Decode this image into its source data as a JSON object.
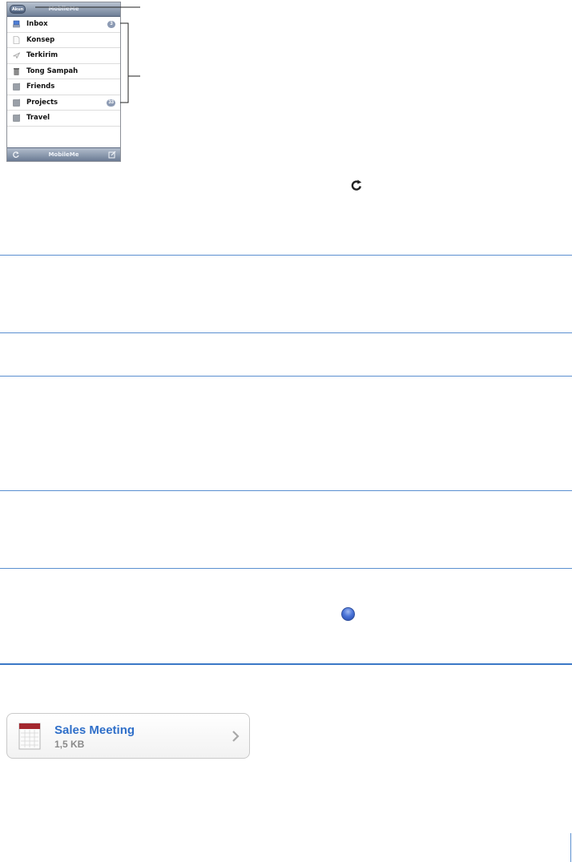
{
  "phone": {
    "back_label": "Akun",
    "nav_title": "MobileMe",
    "mailboxes": [
      {
        "label": "Inbox",
        "icon": "inbox-icon",
        "badge": "3"
      },
      {
        "label": "Konsep",
        "icon": "draft-icon",
        "badge": ""
      },
      {
        "label": "Terkirim",
        "icon": "sent-icon",
        "badge": ""
      },
      {
        "label": "Tong Sampah",
        "icon": "trash-icon",
        "badge": ""
      },
      {
        "label": "Friends",
        "icon": "folder-icon",
        "badge": ""
      },
      {
        "label": "Projects",
        "icon": "folder-icon",
        "badge": "33"
      },
      {
        "label": "Travel",
        "icon": "folder-icon",
        "badge": ""
      }
    ],
    "toolbar_title": "MobileMe"
  },
  "attachment": {
    "title": "Sales Meeting",
    "size": "1,5 KB"
  },
  "colors": {
    "rule": "#5a8fd0",
    "link_blue": "#2f6fc9",
    "badge": "#8c9ab3"
  }
}
